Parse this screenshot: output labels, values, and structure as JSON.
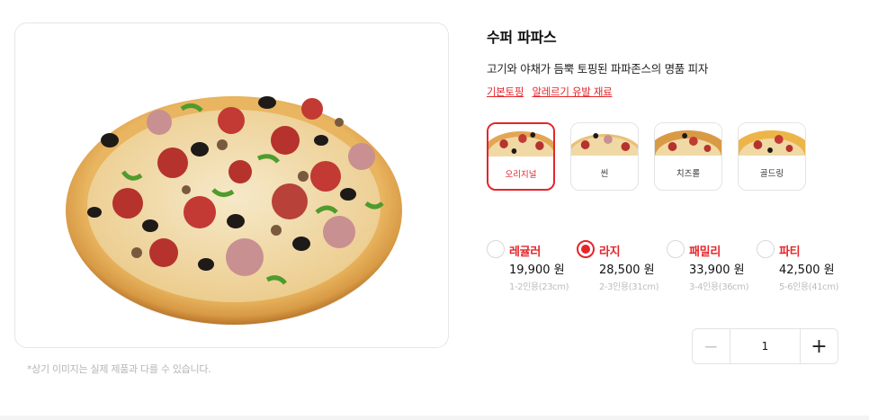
{
  "product": {
    "title": "수퍼 파파스",
    "description": "고기와 야채가 듬뿍 토핑된 파파존스의 명품 피자",
    "links": [
      "기본토핑",
      "알레르기 유발 재료"
    ],
    "image_note": "*상기 이미지는 실제 제품과 다를 수 있습니다."
  },
  "dough_options": [
    {
      "label": "오리지널",
      "selected": true
    },
    {
      "label": "씬",
      "selected": false
    },
    {
      "label": "치즈롤",
      "selected": false
    },
    {
      "label": "골드링",
      "selected": false
    }
  ],
  "sizes": [
    {
      "name": "레귤러",
      "price": "19,900 원",
      "serving": "1-2인용(23cm)",
      "selected": false
    },
    {
      "name": "라지",
      "price": "28,500 원",
      "serving": "2-3인용(31cm)",
      "selected": true
    },
    {
      "name": "패밀리",
      "price": "33,900 원",
      "serving": "3-4인용(36cm)",
      "selected": false
    },
    {
      "name": "파티",
      "price": "42,500 원",
      "serving": "5-6인용(41cm)",
      "selected": false
    }
  ],
  "quantity": {
    "minus": "−",
    "value": "1",
    "plus": "+"
  },
  "colors": {
    "accent": "#e3262b",
    "border": "#e3e3e3",
    "muted": "#bdbdbd"
  },
  "icons": {
    "pizza": "pizza-image",
    "minus": "minus-icon",
    "plus": "plus-icon"
  }
}
